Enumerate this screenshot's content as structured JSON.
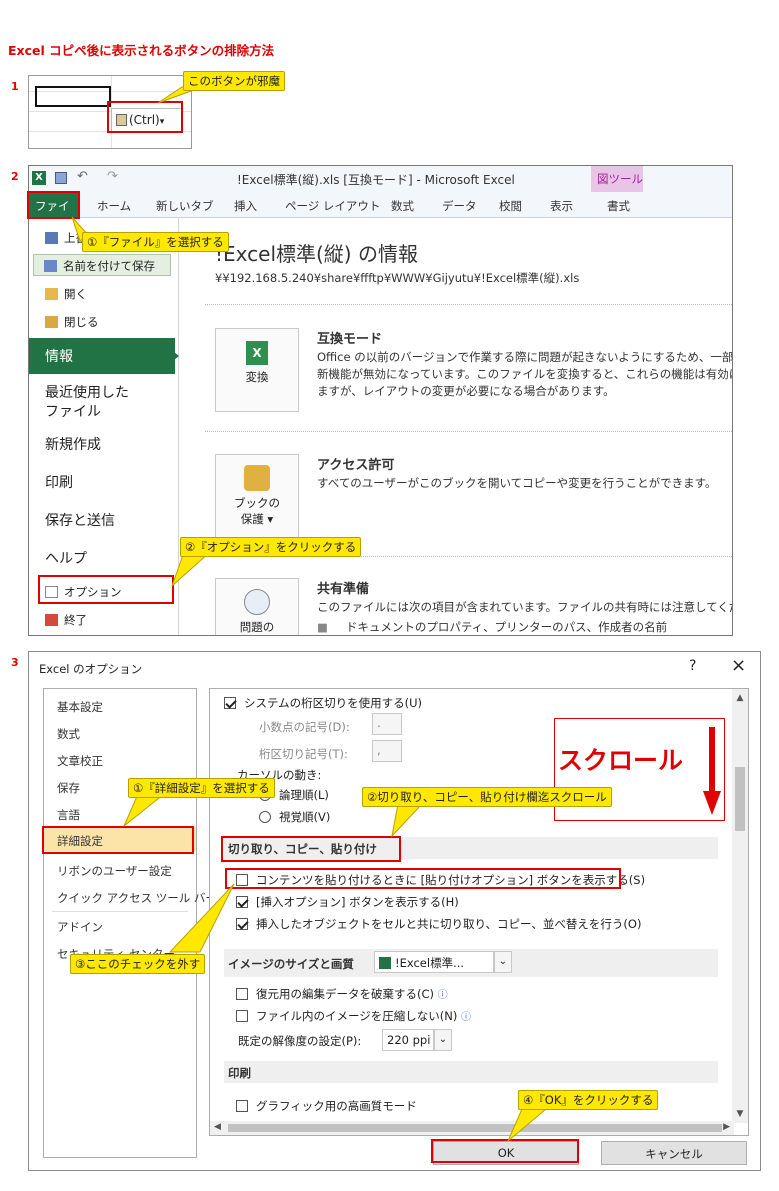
{
  "title": "Excel コピペ後に表示されるボタンの排除方法",
  "steps": [
    "1",
    "2",
    "3"
  ],
  "step1": {
    "paste_button": "(Ctrl)",
    "paste_dropdown": "▾",
    "callout": "このボタンが邪魔"
  },
  "step2": {
    "window_title": "!Excel標準(縦).xls  [互換モード] - Microsoft Excel",
    "context_tab": "図ツール",
    "tabs": [
      "ファイル",
      "ホーム",
      "新しいタブ",
      "挿入",
      "ページ レイアウト",
      "数式",
      "データ",
      "校閲",
      "表示",
      "書式"
    ],
    "menu_small": [
      "上書き保存",
      "名前を付けて保存",
      "開く",
      "閉じる"
    ],
    "menu_big": [
      "情報",
      "最近使用した",
      "ファイル",
      "新規作成",
      "印刷",
      "保存と送信",
      "ヘルプ"
    ],
    "menu_bottom": [
      "オプション",
      "終了"
    ],
    "info_title": "!Excel標準(縦) の情報",
    "info_path": "¥¥192.168.5.240¥share¥ffftp¥WWW¥Gijyutu¥!Excel標準(縦).xls",
    "sections": [
      {
        "button": "変換",
        "heading": "互換モード",
        "lines": [
          "Office の以前のバージョンで作業する際に問題が起きないようにするため、一部の",
          "新機能が無効になっています。このファイルを変換すると、これらの機能は有効にな",
          "ますが、レイアウトの変更が必要になる場合があります。"
        ]
      },
      {
        "button": "ブックの",
        "button2": "保護",
        "heading": "アクセス許可",
        "lines": [
          "すべてのユーザーがこのブックを開いてコピーや変更を行うことができます。"
        ]
      },
      {
        "button": "問題の",
        "heading": "共有準備",
        "lines": [
          "このファイルには次の項目が含まれています。ファイルの共有時には注意してください",
          "ドキュメントのプロパティ、プリンターのパス、作成者の名前"
        ]
      }
    ],
    "callout1": "①『ファイル』を選択する",
    "callout2": "②『オプション』をクリックする"
  },
  "step3": {
    "dialog_title": "Excel のオプション",
    "help_glyph": "?",
    "close_glyph": "×",
    "nav": [
      "基本設定",
      "数式",
      "文章校正",
      "保存",
      "言語",
      "詳細設定",
      "リボンのユーザー設定",
      "クイック アクセス ツール バー",
      "アドイン",
      "セキュリティ センター"
    ],
    "rows": {
      "system_sep": "システムの桁区切りを使用する(U)",
      "decimal_label": "小数点の記号(D):",
      "decimal_value": ".",
      "thousands_label": "桁区切り記号(T):",
      "thousands_value": ",",
      "cursor_label": "カーソルの動き:",
      "logical": "論理順(L)",
      "visual": "視覚順(V)",
      "section_cut": "切り取り、コピー、貼り付け",
      "paste_options": "コンテンツを貼り付けるときに [貼り付けオプション] ボタンを表示する(S)",
      "insert_options": "[挿入オプション] ボタンを表示する(H)",
      "cut_objects": "挿入したオブジェクトをセルと共に切り取り、コピー、並べ替えを行う(O)",
      "section_image": "イメージのサイズと画質",
      "image_file": "!Excel標準...",
      "discard_edit": "復元用の編集データを破棄する(C)",
      "no_compress": "ファイル内のイメージを圧縮しない(N)",
      "resolution_label": "既定の解像度の設定(P):",
      "resolution_value": "220 ppi",
      "section_print": "印刷",
      "hq_graphics": "グラフィック用の高画質モード"
    },
    "scroll_text": "スクロール",
    "ok": "OK",
    "cancel": "キャンセル",
    "callout1": "①『詳細設定』を選択する",
    "callout2": "②切り取り、コピー、貼り付け欄迄スクロール",
    "callout3": "③ここのチェックを外す",
    "callout4": "④『OK』をクリックする"
  },
  "colors": {
    "red": "#e00000",
    "callout": "#ffe800",
    "excel_green": "#217346"
  }
}
